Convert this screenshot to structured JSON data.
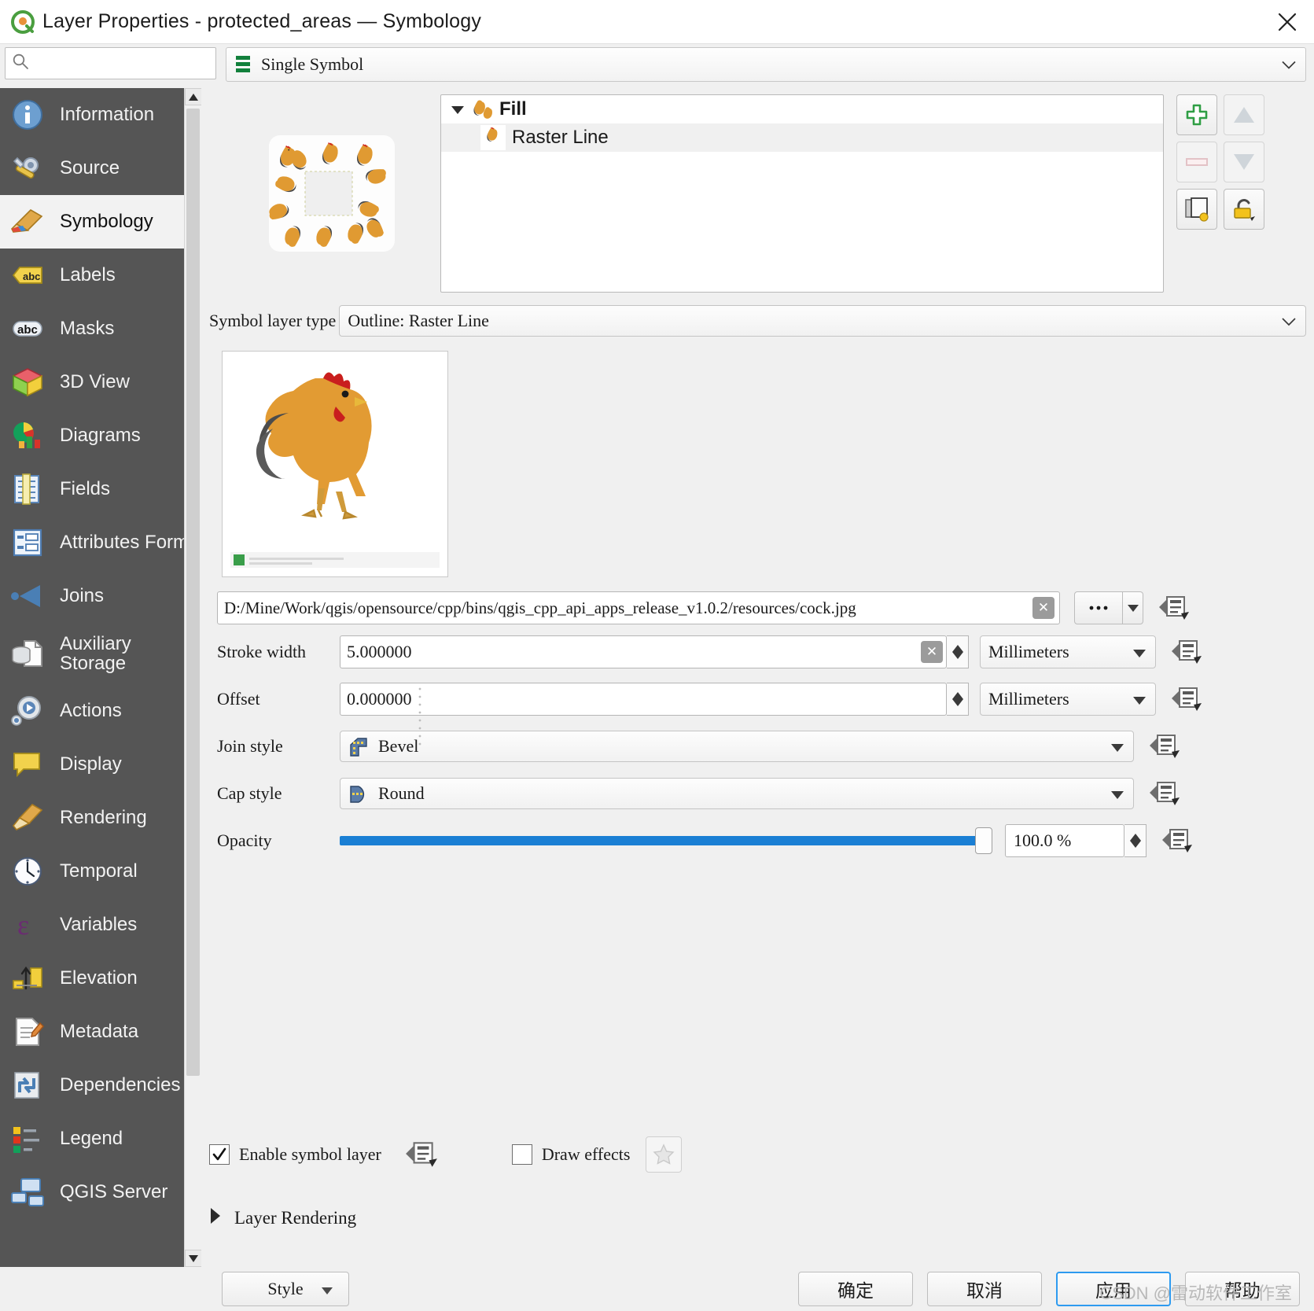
{
  "window": {
    "title": "Layer Properties - protected_areas — Symbology",
    "close_label": "×"
  },
  "search": {
    "placeholder": "",
    "value": "",
    "icon": "search-icon"
  },
  "renderer": {
    "label": "Single Symbol",
    "icon": "single-symbol-icon"
  },
  "sidebar": {
    "items": [
      {
        "label": "Information",
        "icon": "information-icon",
        "active": false
      },
      {
        "label": "Source",
        "icon": "source-icon",
        "active": false
      },
      {
        "label": "Symbology",
        "icon": "symbology-brush-icon",
        "active": true
      },
      {
        "label": "Labels",
        "icon": "labels-abc-icon",
        "active": false
      },
      {
        "label": "Masks",
        "icon": "masks-abc-icon",
        "active": false
      },
      {
        "label": "3D View",
        "icon": "cube-3d-icon",
        "active": false
      },
      {
        "label": "Diagrams",
        "icon": "diagrams-piechart-icon",
        "active": false
      },
      {
        "label": "Fields",
        "icon": "fields-table-icon",
        "active": false
      },
      {
        "label": "Attributes Form",
        "icon": "attributes-form-icon",
        "active": false
      },
      {
        "label": "Joins",
        "icon": "joins-icon",
        "active": false
      },
      {
        "label": "Auxiliary Storage",
        "icon": "auxiliary-storage-icon",
        "active": false,
        "line1": "Auxiliary",
        "line2": "Storage"
      },
      {
        "label": "Actions",
        "icon": "actions-gear-play-icon",
        "active": false
      },
      {
        "label": "Display",
        "icon": "display-balloon-icon",
        "active": false
      },
      {
        "label": "Rendering",
        "icon": "rendering-brush-icon",
        "active": false
      },
      {
        "label": "Temporal",
        "icon": "temporal-clock-icon",
        "active": false
      },
      {
        "label": "Variables",
        "icon": "variables-epsilon-icon",
        "active": false
      },
      {
        "label": "Elevation",
        "icon": "elevation-arrow-icon",
        "active": false
      },
      {
        "label": "Metadata",
        "icon": "metadata-pencil-icon",
        "active": false
      },
      {
        "label": "Dependencies",
        "icon": "dependencies-arrows-icon",
        "active": false
      },
      {
        "label": "Legend",
        "icon": "legend-swatches-icon",
        "active": false
      },
      {
        "label": "QGIS Server",
        "icon": "qgis-server-icon",
        "active": false
      }
    ]
  },
  "symbol_tree": {
    "rows": [
      {
        "label": "Fill",
        "level": 0,
        "bold": true,
        "selected": false,
        "expanded": true
      },
      {
        "label": "Raster Line",
        "level": 1,
        "bold": false,
        "selected": true,
        "expanded": false
      }
    ]
  },
  "tree_tools": [
    {
      "name": "add-symbol-layer-button",
      "icon": "plus-icon",
      "enabled": true
    },
    {
      "name": "move-up-button",
      "icon": "arrow-up-icon",
      "enabled": false
    },
    {
      "name": "remove-symbol-layer-button",
      "icon": "minus-icon",
      "enabled": false
    },
    {
      "name": "move-down-button",
      "icon": "arrow-down-icon",
      "enabled": false
    },
    {
      "name": "duplicate-symbol-layer-button",
      "icon": "copy-icon",
      "enabled": true
    },
    {
      "name": "lock-layer-button",
      "icon": "unlock-icon",
      "enabled": true
    }
  ],
  "fields": {
    "symbol_layer_type_label": "Symbol layer type",
    "symbol_layer_type_value": "Outline: Raster Line",
    "image_path_value": "D:/Mine/Work/qgis/opensource/cpp/bins/qgis_cpp_api_apps_release_v1.0.2/resources/cock.jpg",
    "browse_label": "…",
    "stroke_width_label": "Stroke width",
    "stroke_width_value": "5.000000",
    "stroke_width_unit": "Millimeters",
    "offset_label": "Offset",
    "offset_value": "0.000000",
    "offset_unit": "Millimeters",
    "join_style_label": "Join style",
    "join_style_value": "Bevel",
    "cap_style_label": "Cap style",
    "cap_style_value": "Round",
    "opacity_label": "Opacity",
    "opacity_value": "100.0 %",
    "opacity_percent": 100
  },
  "options": {
    "enable_symbol_layer_label": "Enable symbol layer",
    "enable_symbol_layer_checked": true,
    "draw_effects_label": "Draw effects",
    "draw_effects_checked": false
  },
  "layer_rendering": {
    "label": "Layer Rendering",
    "expanded": false
  },
  "footer": {
    "style_label": "Style",
    "ok_label": "确定",
    "cancel_label": "取消",
    "apply_label": "应用",
    "help_label": "帮助",
    "watermark": "CSDN @雷动软件工作室"
  },
  "colors": {
    "sidebar_bg": "#555555",
    "accent_blue": "#1a7fd4",
    "primary_border": "#2e9bf0",
    "green": "#2f9e44"
  }
}
